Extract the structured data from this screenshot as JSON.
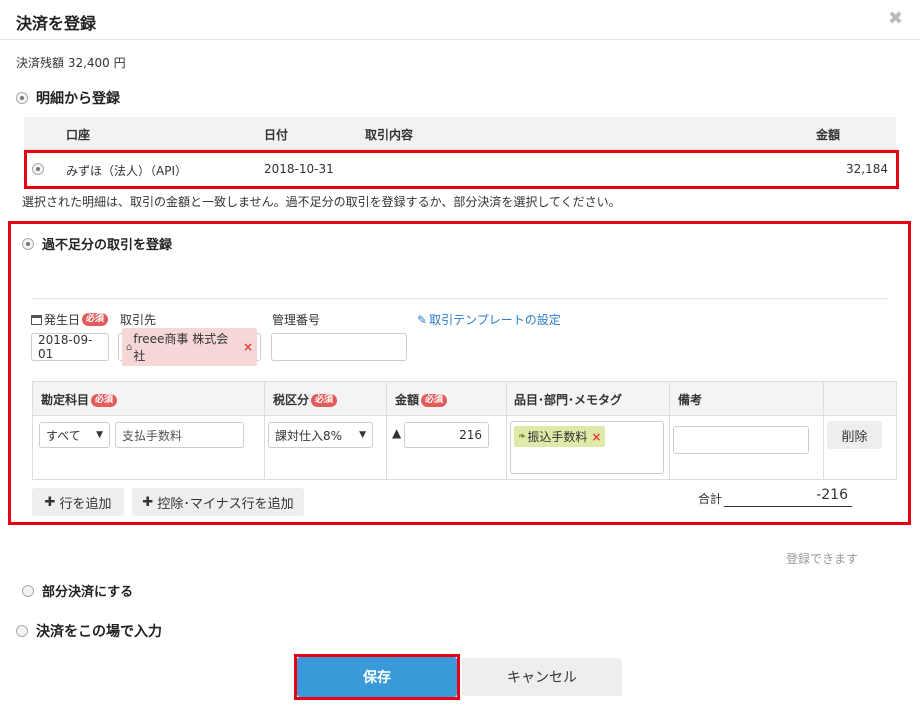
{
  "dialog": {
    "title": "決済を登録",
    "close_glyph": "✖"
  },
  "balance": "決済残額 32,400 円",
  "from_statement": {
    "label": "明細から登録",
    "columns": {
      "account": "口座",
      "date": "日付",
      "content": "取引内容",
      "amount": "金額"
    },
    "row": {
      "account": "みずほ（法人）（API）",
      "date": "2018-10-31",
      "content": "",
      "amount": "32,184"
    },
    "notice": "選択された明細は、取引の金額と一致しません。過不足分の取引を登録するか、部分決済を選択してください。"
  },
  "surplus": {
    "label": "過不足分の取引を登録",
    "required_badge": "必須",
    "fields": {
      "date_label": "発生日",
      "date_value": "2018-09-01",
      "partner_label": "取引先",
      "partner_value": "freee商事 株式会社",
      "mgmt_label": "管理番号",
      "mgmt_value": "",
      "template_link": "取引テンプレートの設定"
    },
    "grid": {
      "headers": {
        "account": "勘定科目",
        "tax": "税区分",
        "amount": "金額",
        "items": "品目･部門･メモタグ",
        "note": "備考"
      },
      "row": {
        "account_filter": "すべて",
        "account_value": "支払手数料",
        "tax_value": "課対仕入8%",
        "amount_sign": "▲",
        "amount_value": "216",
        "item_tag": "振込手数料",
        "note_value": "",
        "delete_label": "削除"
      }
    },
    "add_row_label": "行を追加",
    "add_deduction_label": "控除･マイナス行を追加",
    "total_label": "合計",
    "total_value": "-216"
  },
  "status_text": "登録できます",
  "partial": {
    "label": "部分決済にする"
  },
  "manual": {
    "label": "決済をこの場で入力"
  },
  "buttons": {
    "save": "保存",
    "cancel": "キャンセル"
  },
  "colors": {
    "save": "#3a9ad9",
    "highlight": "#e60012",
    "tag_partner": "#f6d7d7",
    "tag_item": "#dfe9a8"
  }
}
